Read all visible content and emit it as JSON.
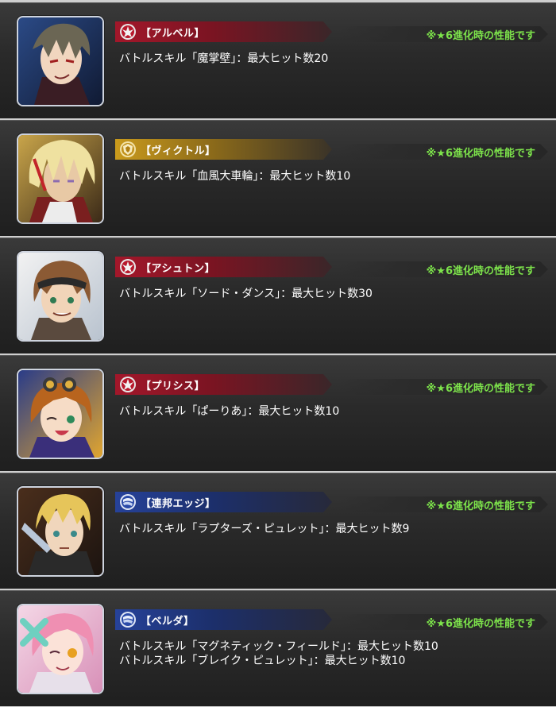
{
  "note_label": "※★6進化時の性能です",
  "characters": [
    {
      "name": "【アルベル】",
      "faction": "red",
      "emblem": "phoenix-emblem-icon",
      "portrait": "albel-portrait",
      "skills": [
        "バトルスキル「魔掌壁」：最大ヒット数20"
      ]
    },
    {
      "name": "【ヴィクトル】",
      "faction": "gold",
      "emblem": "shield-emblem-icon",
      "portrait": "victor-portrait",
      "skills": [
        "バトルスキル「血風大車輪」：最大ヒット数10"
      ]
    },
    {
      "name": "【アシュトン】",
      "faction": "red",
      "emblem": "phoenix-emblem-icon",
      "portrait": "ashton-portrait",
      "skills": [
        "バトルスキル「ソード・ダンス」：最大ヒット数30"
      ]
    },
    {
      "name": "【プリシス】",
      "faction": "red",
      "emblem": "phoenix-emblem-icon",
      "portrait": "precis-portrait",
      "skills": [
        "バトルスキル「ぱーりあ」：最大ヒット数10"
      ]
    },
    {
      "name": "【連邦エッジ】",
      "faction": "blue",
      "emblem": "federation-emblem-icon",
      "portrait": "edge-portrait",
      "skills": [
        "バトルスキル「ラプターズ・ピュレット」：最大ヒット数9"
      ]
    },
    {
      "name": "【ベルダ】",
      "faction": "blue",
      "emblem": "federation-emblem-icon",
      "portrait": "belda-portrait",
      "skills": [
        "バトルスキル「マグネティック・フィールド」：最大ヒット数10",
        "バトルスキル「ブレイク・ピュレット」：最大ヒット数10"
      ]
    }
  ],
  "colors": {
    "red": "#a3172a",
    "gold": "#c99a1c",
    "blue": "#26429a",
    "note": "#7de34b"
  }
}
